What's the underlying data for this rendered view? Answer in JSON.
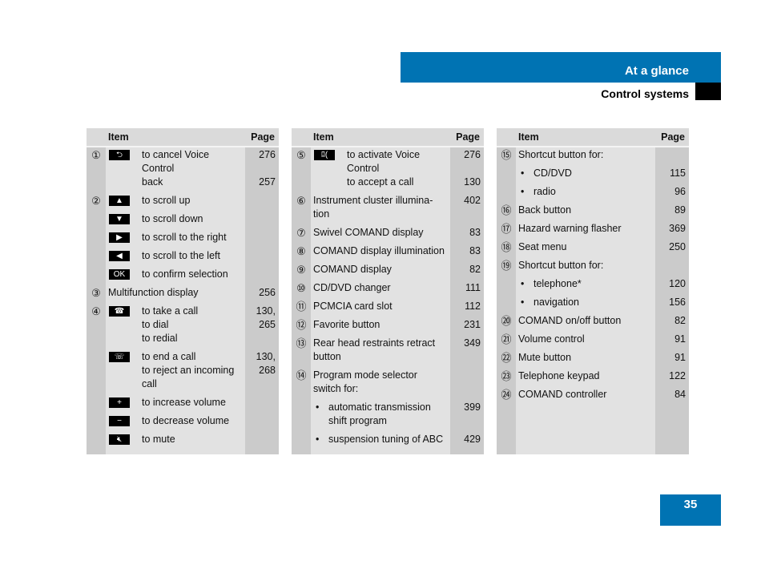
{
  "header": {
    "section": "At a glance",
    "subsection": "Control systems"
  },
  "page_number": "35",
  "colors": {
    "accent": "#0073b3",
    "column_dark": "#cbcbcb",
    "column_light": "#e2e2e2"
  },
  "tables": [
    {
      "col_item": "Item",
      "col_page": "Page",
      "rows": [
        {
          "num": "①",
          "icon": "back-icon",
          "glyph": "⮌",
          "text": [
            "to cancel Voice",
            "Control",
            "back"
          ],
          "page": [
            "276",
            "",
            "257"
          ]
        },
        {
          "num": "②",
          "icon": "arrow-up-icon",
          "glyph": "▲",
          "text": [
            "to scroll up"
          ],
          "page": [
            ""
          ]
        },
        {
          "num": "",
          "icon": "arrow-down-icon",
          "glyph": "▼",
          "text": [
            "to scroll down"
          ],
          "page": [
            ""
          ]
        },
        {
          "num": "",
          "icon": "arrow-right-icon",
          "glyph": "▶",
          "text": [
            "to scroll to the right"
          ],
          "page": [
            ""
          ]
        },
        {
          "num": "",
          "icon": "arrow-left-icon",
          "glyph": "◀",
          "text": [
            "to scroll to the left"
          ],
          "page": [
            ""
          ]
        },
        {
          "num": "",
          "icon": "ok-icon",
          "glyph": "OK",
          "text": [
            "to confirm selection"
          ],
          "page": [
            ""
          ]
        },
        {
          "num": "③",
          "text": [
            "Multifunction display"
          ],
          "page": [
            "256"
          ]
        },
        {
          "num": "④",
          "icon": "phone-pickup-icon",
          "glyph": "☎",
          "text": [
            "to take a call",
            "to dial",
            "to redial"
          ],
          "page": [
            "130,",
            "265",
            ""
          ]
        },
        {
          "num": "",
          "icon": "phone-hangup-icon",
          "glyph": "☏",
          "text": [
            "to end a call",
            "to reject an incoming",
            "call"
          ],
          "page": [
            "130,",
            "268",
            ""
          ]
        },
        {
          "num": "",
          "icon": "plus-icon",
          "glyph": "+",
          "text": [
            "to increase volume"
          ],
          "page": [
            ""
          ]
        },
        {
          "num": "",
          "icon": "minus-icon",
          "glyph": "−",
          "text": [
            "to decrease volume"
          ],
          "page": [
            ""
          ]
        },
        {
          "num": "",
          "icon": "mute-icon",
          "glyph": "🔇︎",
          "text": [
            "to mute"
          ],
          "page": [
            ""
          ]
        }
      ]
    },
    {
      "col_item": "Item",
      "col_page": "Page",
      "rows": [
        {
          "num": "⑤",
          "icon": "voice-control-icon",
          "glyph": "ﾛ(",
          "text": [
            "to activate Voice",
            "Control",
            "to accept a call"
          ],
          "page": [
            "276",
            "",
            "130"
          ]
        },
        {
          "num": "⑥",
          "text": [
            "Instrument cluster illumina-",
            "tion"
          ],
          "page": [
            "402",
            ""
          ]
        },
        {
          "num": "⑦",
          "text": [
            "Swivel COMAND display"
          ],
          "page": [
            "83"
          ]
        },
        {
          "num": "⑧",
          "text": [
            "COMAND display illumination"
          ],
          "page": [
            "83"
          ]
        },
        {
          "num": "⑨",
          "text": [
            "COMAND display"
          ],
          "page": [
            "82"
          ]
        },
        {
          "num": "⑩",
          "text": [
            "CD/DVD changer"
          ],
          "page": [
            "111"
          ]
        },
        {
          "num": "⑪",
          "text": [
            "PCMCIA card slot"
          ],
          "page": [
            "112"
          ]
        },
        {
          "num": "⑫",
          "text": [
            "Favorite button"
          ],
          "page": [
            "231"
          ]
        },
        {
          "num": "⑬",
          "text": [
            "Rear head restraints retract",
            "button"
          ],
          "page": [
            "349",
            ""
          ]
        },
        {
          "num": "⑭",
          "text": [
            "Program mode selector",
            "switch for:"
          ],
          "page": [
            "",
            ""
          ]
        },
        {
          "num": "",
          "bullet": true,
          "text": [
            "automatic transmission",
            "shift program"
          ],
          "page": [
            "399",
            ""
          ]
        },
        {
          "num": "",
          "bullet": true,
          "text": [
            "suspension tuning of ABC"
          ],
          "page": [
            "429"
          ]
        }
      ]
    },
    {
      "col_item": "Item",
      "col_page": "Page",
      "rows": [
        {
          "num": "⑮",
          "text": [
            "Shortcut button for:"
          ],
          "page": [
            ""
          ]
        },
        {
          "num": "",
          "bullet": true,
          "text": [
            "CD/DVD"
          ],
          "page": [
            "115"
          ]
        },
        {
          "num": "",
          "bullet": true,
          "text": [
            "radio"
          ],
          "page": [
            "96"
          ]
        },
        {
          "num": "⑯",
          "text": [
            "Back button"
          ],
          "page": [
            "89"
          ]
        },
        {
          "num": "⑰",
          "text": [
            "Hazard warning flasher"
          ],
          "page": [
            "369"
          ]
        },
        {
          "num": "⑱",
          "text": [
            "Seat menu"
          ],
          "page": [
            "250"
          ]
        },
        {
          "num": "⑲",
          "text": [
            "Shortcut button for:"
          ],
          "page": [
            ""
          ]
        },
        {
          "num": "",
          "bullet": true,
          "text": [
            "telephone*"
          ],
          "page": [
            "120"
          ]
        },
        {
          "num": "",
          "bullet": true,
          "text": [
            "navigation"
          ],
          "page": [
            "156"
          ]
        },
        {
          "num": "⑳",
          "text": [
            "COMAND on/off button"
          ],
          "page": [
            "82"
          ]
        },
        {
          "num": "㉑",
          "text": [
            "Volume control"
          ],
          "page": [
            "91"
          ]
        },
        {
          "num": "㉒",
          "text": [
            "Mute button"
          ],
          "page": [
            "91"
          ]
        },
        {
          "num": "㉓",
          "text": [
            "Telephone keypad"
          ],
          "page": [
            "122"
          ]
        },
        {
          "num": "㉔",
          "text": [
            "COMAND controller"
          ],
          "page": [
            "84"
          ]
        }
      ]
    }
  ]
}
